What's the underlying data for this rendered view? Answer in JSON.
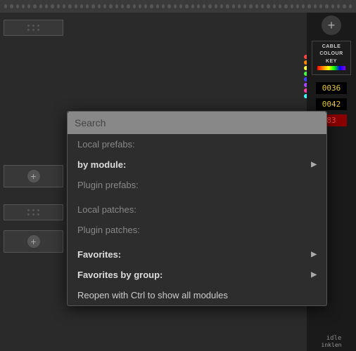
{
  "topStrip": {
    "dotCount": 60
  },
  "rightPanel": {
    "plusLabel": "+",
    "cableColour": {
      "line1": "CABLE",
      "line2": "CoLouR",
      "line3": "KEY"
    },
    "display1": "0036",
    "display2": "0042",
    "display3": "83",
    "statusIdle": "idle",
    "statusInklen": "inklen"
  },
  "contextMenu": {
    "searchPlaceholder": "Search",
    "items": [
      {
        "label": "Local prefabs:",
        "arrow": false,
        "grayed": true,
        "bold": false
      },
      {
        "label": "by module:",
        "arrow": true,
        "grayed": false,
        "bold": true
      },
      {
        "label": "Plugin prefabs:",
        "arrow": false,
        "grayed": true,
        "bold": false
      },
      {
        "label": "",
        "divider": true
      },
      {
        "label": "Local patches:",
        "arrow": false,
        "grayed": true,
        "bold": false
      },
      {
        "label": "Plugin patches:",
        "arrow": false,
        "grayed": true,
        "bold": false
      },
      {
        "label": "",
        "divider": true
      },
      {
        "label": "Favorites:",
        "arrow": true,
        "grayed": false,
        "bold": true
      },
      {
        "label": "Favorites by group:",
        "arrow": true,
        "grayed": false,
        "bold": true
      },
      {
        "label": "Reopen with Ctrl to show all modules",
        "arrow": false,
        "grayed": false,
        "bold": false
      }
    ]
  },
  "cableLines": [
    "#ff4444",
    "#ff8800",
    "#ffff44",
    "#44ff44",
    "#4444ff",
    "#aa44ff",
    "#ff44aa",
    "#44ffff"
  ]
}
